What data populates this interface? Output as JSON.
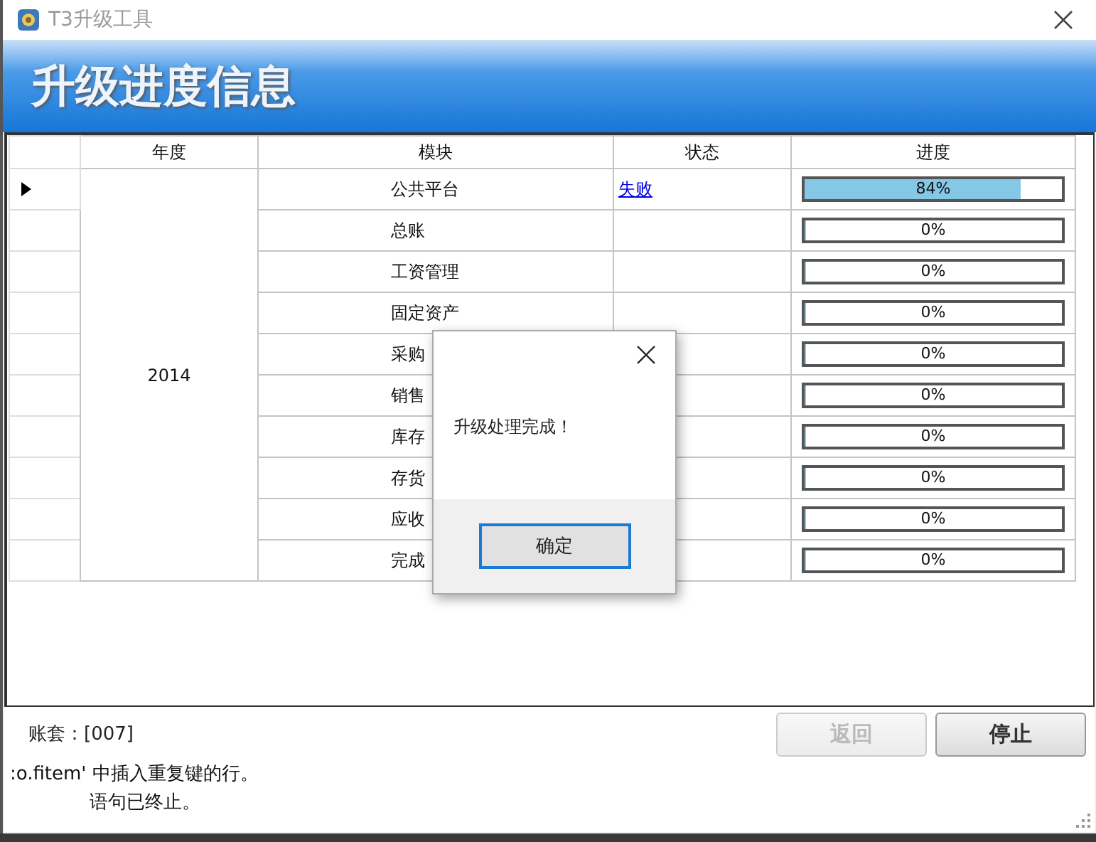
{
  "window": {
    "title": "T3升级工具"
  },
  "banner": {
    "title": "升级进度信息"
  },
  "table": {
    "columns": [
      "年度",
      "模块",
      "状态",
      "进度"
    ],
    "year": "2014",
    "rows": [
      {
        "module": "公共平台",
        "status": "失败",
        "progress": "84%",
        "level": 0.84,
        "selected": true
      },
      {
        "module": "总账",
        "progress": "0%",
        "level": 0,
        "selected": false
      },
      {
        "module": "工资管理",
        "progress": "0%",
        "level": 0,
        "selected": false
      },
      {
        "module": "固定资产",
        "progress": "0%",
        "level": 0,
        "selected": false
      },
      {
        "module": "采购",
        "progress": "0%",
        "level": 0,
        "selected": false
      },
      {
        "module": "销售",
        "progress": "0%",
        "level": 0,
        "selected": false
      },
      {
        "module": "库存",
        "progress": "0%",
        "level": 0,
        "selected": false
      },
      {
        "module": "存货",
        "progress": "0%",
        "level": 0,
        "selected": false
      },
      {
        "module": "应收",
        "progress": "0%",
        "level": 0,
        "selected": false
      },
      {
        "module": "完成",
        "progress": "0%",
        "level": 0,
        "selected": false
      }
    ]
  },
  "account": "账套：[007]",
  "buttons": [
    {
      "label": "返回",
      "disabled": true
    },
    {
      "label": "停止",
      "disabled": false
    }
  ],
  "log": [
    ":o.fitem' 中插入重复键的行。",
    "语句已终止。"
  ],
  "dialog": {
    "message": "升级处理完成！",
    "ok": "确定"
  }
}
